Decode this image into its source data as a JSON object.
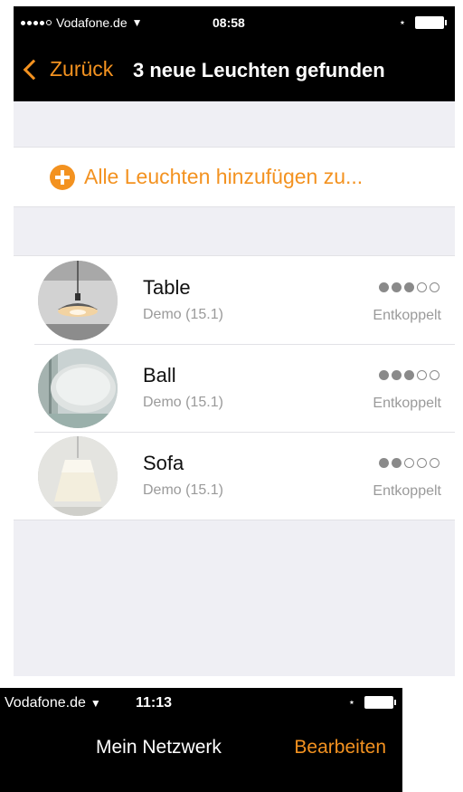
{
  "screen1": {
    "status_bar": {
      "carrier": "Vodafone.de",
      "time": "08:58"
    },
    "nav": {
      "back_label": "Zurück",
      "title": "3 neue Leuchten gefunden"
    },
    "add_all_label": "Alle Leuchten hinzufügen zu...",
    "lights": [
      {
        "name": "Table",
        "subtitle": "Demo (15.1)",
        "status": "Entkoppelt",
        "signal_strength": 3,
        "signal_max": 5
      },
      {
        "name": "Ball",
        "subtitle": "Demo (15.1)",
        "status": "Entkoppelt",
        "signal_strength": 3,
        "signal_max": 5
      },
      {
        "name": "Sofa",
        "subtitle": "Demo (15.1)",
        "status": "Entkoppelt",
        "signal_strength": 2,
        "signal_max": 5
      }
    ]
  },
  "screen2": {
    "status_bar": {
      "carrier": "Vodafone.de",
      "time": "11:13"
    },
    "nav": {
      "title": "Mein Netzwerk",
      "edit_label": "Bearbeiten"
    }
  },
  "colors": {
    "accent": "#f39220",
    "background": "#efeff4",
    "bar": "#000000"
  },
  "icons": [
    "signal-dots-icon",
    "wifi-icon",
    "bluetooth-icon",
    "battery-icon",
    "back-chevron-icon",
    "plus-circle-icon"
  ]
}
